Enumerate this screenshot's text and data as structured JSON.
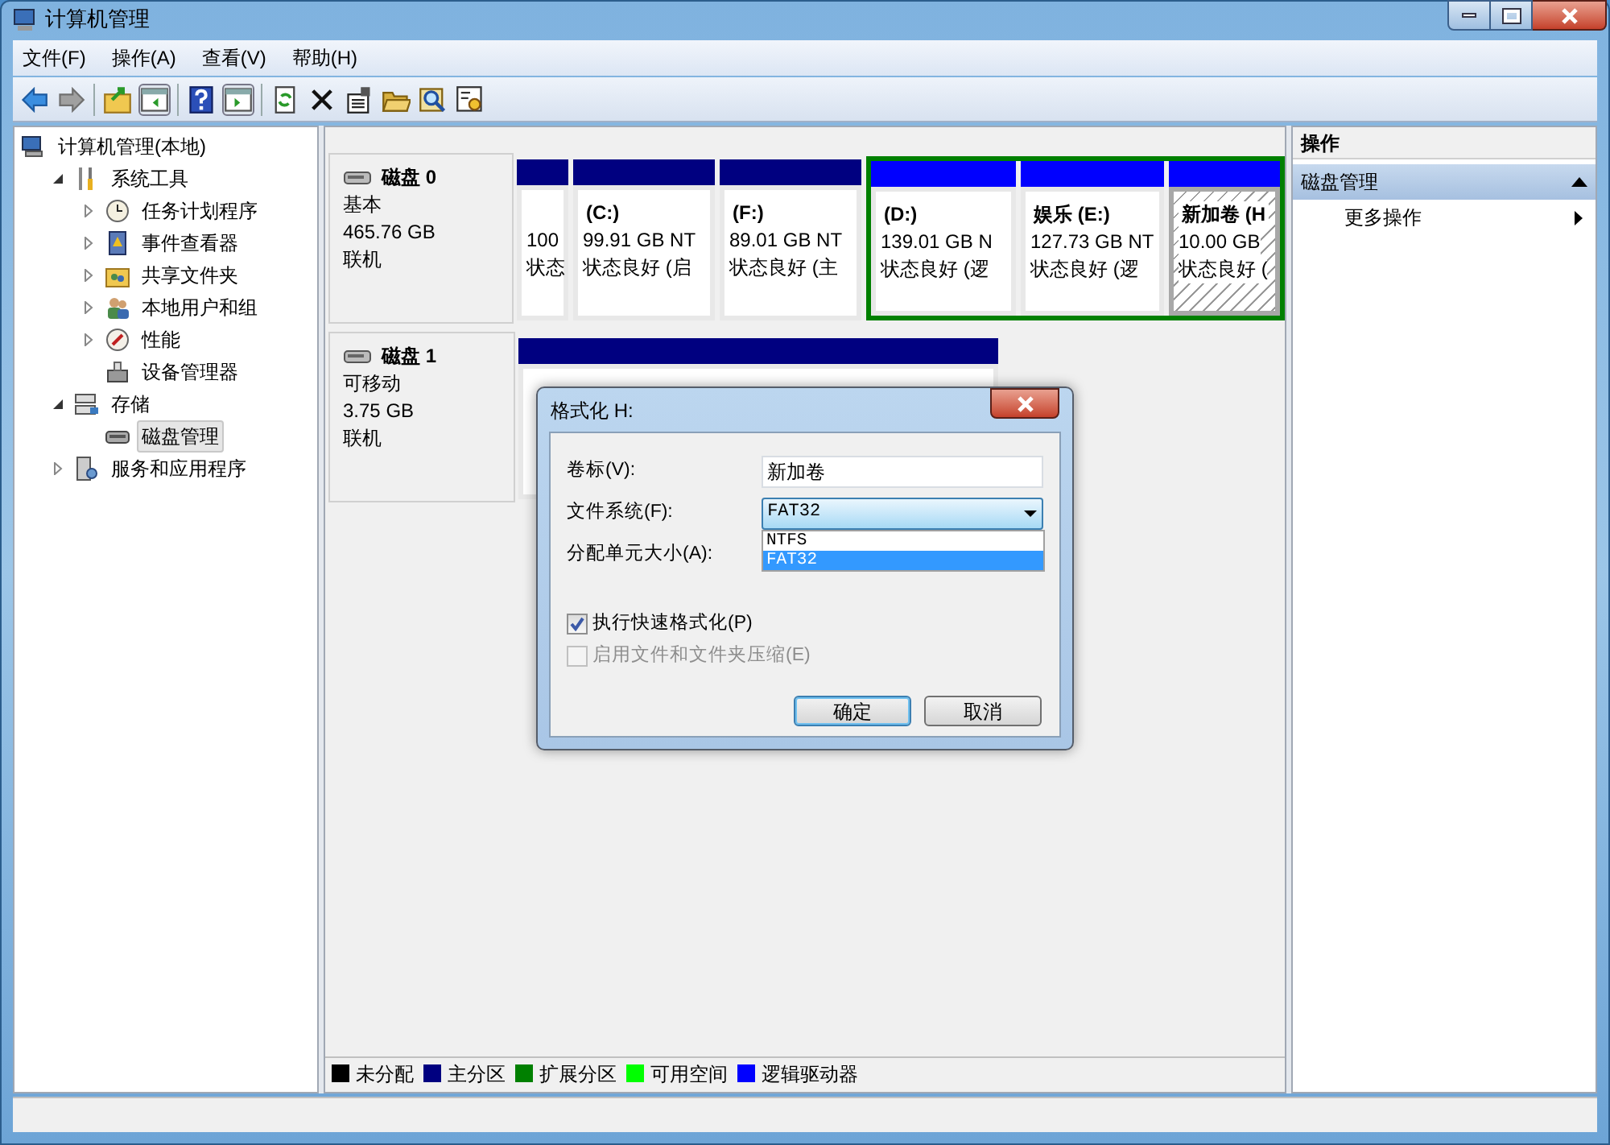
{
  "window": {
    "title": "计算机管理"
  },
  "menu": [
    "文件(F)",
    "操作(A)",
    "查看(V)",
    "帮助(H)"
  ],
  "tree": [
    {
      "label": "计算机管理(本地)",
      "selected": false,
      "children": [
        {
          "label": "系统工具",
          "selected": false,
          "expanded": true,
          "children": [
            {
              "label": "任务计划程序",
              "selected": false,
              "expanded": false
            },
            {
              "label": "事件查看器",
              "selected": false,
              "expanded": false
            },
            {
              "label": "共享文件夹",
              "selected": false,
              "expanded": false
            },
            {
              "label": "本地用户和组",
              "selected": false,
              "expanded": false
            },
            {
              "label": "性能",
              "selected": false,
              "expanded": false
            },
            {
              "label": "设备管理器",
              "selected": false
            }
          ]
        },
        {
          "label": "存储",
          "selected": false,
          "expanded": true,
          "children": [
            {
              "label": "磁盘管理",
              "selected": true
            }
          ]
        },
        {
          "label": "服务和应用程序",
          "selected": false,
          "expanded": false
        }
      ]
    }
  ],
  "disks": [
    {
      "name": "磁盘 0",
      "type": "基本",
      "size": "465.76 GB",
      "status": "联机",
      "partitions": [
        {
          "kind": "primary",
          "selected": false,
          "lines": [
            "100",
            "状态"
          ]
        },
        {
          "kind": "primary",
          "selected": false,
          "label": "(C:)",
          "lines": [
            "99.91 GB NT",
            "状态良好 (启"
          ]
        },
        {
          "kind": "primary",
          "selected": false,
          "label": "(F:)",
          "lines": [
            "89.01 GB NT",
            "状态良好 (主"
          ]
        },
        {
          "kind": "extended",
          "selected": false,
          "children": [
            {
              "kind": "logical",
              "selected": false,
              "label": "(D:)",
              "lines": [
                "139.01 GB N",
                "状态良好 (逻"
              ]
            },
            {
              "kind": "logical",
              "selected": false,
              "label": "娱乐 (E:)",
              "lines": [
                "127.73 GB NT",
                "状态良好 (逻"
              ]
            },
            {
              "kind": "logical",
              "selected": true,
              "label": "新加卷 (H",
              "lines": [
                "10.00 GB",
                "状态良好 ("
              ]
            }
          ]
        }
      ]
    },
    {
      "name": "磁盘 1",
      "type": "可移动",
      "size": "3.75 GB",
      "status": "联机",
      "partitions": [
        {
          "kind": "primary",
          "selected": false
        }
      ]
    }
  ],
  "legend": [
    {
      "label": "未分配",
      "color": "#000000"
    },
    {
      "label": "主分区",
      "color": "#000080"
    },
    {
      "label": "扩展分区",
      "color": "#008000"
    },
    {
      "label": "可用空间",
      "color": "#00ff00"
    },
    {
      "label": "逻辑驱动器",
      "color": "#0000ff"
    }
  ],
  "actions": {
    "title": "操作",
    "sections": [
      {
        "label": "磁盘管理",
        "expanded": true,
        "items": [
          {
            "label": "更多操作"
          }
        ]
      }
    ]
  },
  "dialog": {
    "title": "格式化 H:",
    "fields": [
      {
        "kind": "text",
        "label": "卷标(V):",
        "value": "新加卷"
      },
      {
        "kind": "select",
        "label": "文件系统(F):",
        "value": "FAT32",
        "open": true,
        "options": [
          {
            "label": "NTFS",
            "selected": false
          },
          {
            "label": "FAT32",
            "selected": true
          }
        ]
      },
      {
        "kind": "hidden",
        "label": "分配单元大小(A):"
      }
    ],
    "checkboxes": [
      {
        "label": "执行快速格式化(P)",
        "checked": true,
        "disabled": false
      },
      {
        "label": "启用文件和文件夹压缩(E)",
        "checked": false,
        "disabled": true
      }
    ],
    "buttons": [
      {
        "label": "确定",
        "default": true
      },
      {
        "label": "取消",
        "default": false
      }
    ]
  }
}
